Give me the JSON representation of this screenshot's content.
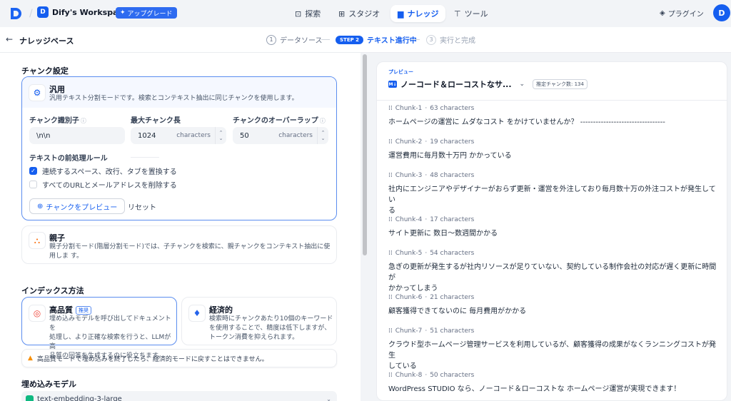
{
  "topbar": {
    "workspace_initial": "D",
    "workspace_name": "Dify's Workspace",
    "upgrade_label": "アップグレード",
    "nav": [
      {
        "label": "探索"
      },
      {
        "label": "スタジオ"
      },
      {
        "label": "ナレッジ"
      },
      {
        "label": "ツール"
      }
    ],
    "plugin_label": "プラグイン",
    "user_initial": "D"
  },
  "stepbar": {
    "breadcrumb": "ナレッジベース",
    "step1_num": "1",
    "step1_label": "データソース",
    "step2_pill": "STEP 2",
    "step2_label": "テキスト進行中",
    "step3_num": "3",
    "step3_label": "実行と完成"
  },
  "chunk_settings": {
    "title": "チャンク設定",
    "general": {
      "title": "汎用",
      "desc": "汎用テキスト分割モードです。検索とコンテキスト抽出に同じチャンクを使用します。",
      "delimiter_label": "チャンク識別子",
      "delimiter_value": "\\n\\n",
      "max_len_label": "最大チャンク長",
      "max_len_value": "1024",
      "max_len_unit": "characters",
      "overlap_label": "チャンクのオーバーラップ",
      "overlap_value": "50",
      "overlap_unit": "characters",
      "rules_title": "テキストの前処理ルール",
      "rule1": "連続するスペース、改行、タブを置換する",
      "rule1_checked": true,
      "rule2": "すべてのURLとメールアドレスを削除する",
      "rule2_checked": false,
      "preview_btn": "チャンクをプレビュー",
      "reset_btn": "リセット"
    },
    "parent_child": {
      "title": "親子",
      "desc": "親子分割モード(階層分割モード)では、子チャンクを検索に、親チャンクをコンテキスト抽出に使用しま す。"
    }
  },
  "index": {
    "title": "インデックス方法",
    "high": {
      "title": "高品質",
      "badge": "推奨",
      "desc_l1": "埋め込みモデルを呼び出してドキュメントを",
      "desc_l2": "処理し、より正確な検索を行うと、LLMが高",
      "desc_l3": "品質の回答を生成するのに役立ちます。"
    },
    "eco": {
      "title": "経済的",
      "desc_l1": "検索時にチャンクあたり10個のキーワード",
      "desc_l2": "を使用することで、精度は低下しますが、",
      "desc_l3": "トークン消費を抑えられます。"
    },
    "warning": "高品質モードで埋め込みを終了したら、経済的モードに戻すことはできません。"
  },
  "embedding": {
    "title": "埋め込みモデル",
    "model": "text-embedding-3-large"
  },
  "preview": {
    "label": "プレビュー",
    "doc_badge": "M↓",
    "doc_name": "ノーコード＆ローコストなサ...",
    "estimate": "推定チャンク数: 134",
    "chunks": [
      {
        "id": "Chunk-1",
        "chars": "63 characters",
        "l1": "ホームページの運営に ムダなコスト をかけていませんか？ ---------------------------------",
        "l2": ""
      },
      {
        "id": "Chunk-2",
        "chars": "19 characters",
        "l1": "運営費用に毎月数十万円 かかっている",
        "l2": ""
      },
      {
        "id": "Chunk-3",
        "chars": "48 characters",
        "l1": "社内にエンジニアやデザイナーがおらず更新・運営を外注しており毎月数十万の外注コストが発生してい",
        "l2": "る"
      },
      {
        "id": "Chunk-4",
        "chars": "17 characters",
        "l1": "サイト更新に 数日〜数週間かかる",
        "l2": ""
      },
      {
        "id": "Chunk-5",
        "chars": "54 characters",
        "l1": "急ぎの更新が発生するが社内リソースが足りていない、契約している制作会社の対応が遅く更新に時間が",
        "l2": "かかってしまう"
      },
      {
        "id": "Chunk-6",
        "chars": "21 characters",
        "l1": "顧客獲得できてないのに 毎月費用がかかる",
        "l2": ""
      },
      {
        "id": "Chunk-7",
        "chars": "51 characters",
        "l1": "クラウド型ホームページ管理サービスを利用しているが、顧客獲得の成果がなくランニングコストが発生",
        "l2": "している"
      },
      {
        "id": "Chunk-8",
        "chars": "50 characters",
        "l1": "WordPress STUDIO なら、ノーコード＆ローコストな ホームページ運営が実現できます！",
        "l2": ""
      }
    ]
  }
}
